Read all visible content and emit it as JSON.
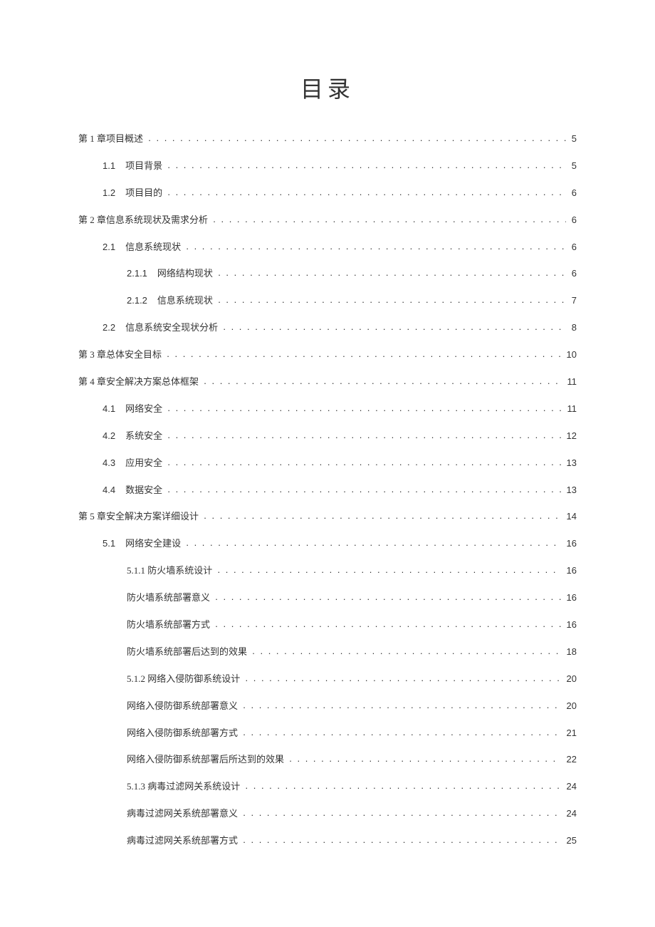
{
  "title": "目录",
  "entries": [
    {
      "indent": 0,
      "num": "",
      "label": "第 1 章项目概述",
      "page": "5"
    },
    {
      "indent": 1,
      "num": "1.1",
      "label": "项目背景",
      "page": "5"
    },
    {
      "indent": 1,
      "num": "1.2",
      "label": "项目目的",
      "page": "6"
    },
    {
      "indent": 0,
      "num": "",
      "label": "第 2 章信息系统现状及需求分析",
      "page": "6"
    },
    {
      "indent": 1,
      "num": "2.1",
      "label": "信息系统现状",
      "page": "6"
    },
    {
      "indent": 2,
      "num": "2.1.1",
      "label": "网络结构现状",
      "page": "6"
    },
    {
      "indent": 2,
      "num": "2.1.2",
      "label": "信息系统现状",
      "page": "7"
    },
    {
      "indent": 1,
      "num": "2.2",
      "label": "信息系统安全现状分析",
      "page": "8"
    },
    {
      "indent": 0,
      "num": "",
      "label": "第 3 章总体安全目标",
      "page": "10"
    },
    {
      "indent": 0,
      "num": "",
      "label": "第 4 章安全解决方案总体框架",
      "page": "11"
    },
    {
      "indent": 1,
      "num": "4.1",
      "label": "网络安全",
      "page": "11"
    },
    {
      "indent": 1,
      "num": "4.2",
      "label": "系统安全",
      "page": "12"
    },
    {
      "indent": 1,
      "num": "4.3",
      "label": "应用安全",
      "page": "13"
    },
    {
      "indent": 1,
      "num": "4.4",
      "label": "数据安全",
      "page": "13"
    },
    {
      "indent": 0,
      "num": "",
      "label": "第 5 章安全解决方案详细设计",
      "page": "14"
    },
    {
      "indent": 1,
      "num": "5.1",
      "label": "网络安全建设",
      "page": "16"
    },
    {
      "indent": 2,
      "num": "",
      "label": "5.1.1 防火墙系统设计",
      "page": "16"
    },
    {
      "indent": 2,
      "num": "",
      "label": "防火墙系统部署意义",
      "page": "16"
    },
    {
      "indent": 2,
      "num": "",
      "label": "防火墙系统部署方式",
      "page": "16"
    },
    {
      "indent": 2,
      "num": "",
      "label": "防火墙系统部署后达到的效果",
      "page": "18"
    },
    {
      "indent": 2,
      "num": "",
      "label": "5.1.2 网络入侵防御系统设计",
      "page": "20"
    },
    {
      "indent": 2,
      "num": "",
      "label": "网络入侵防御系统部署意义",
      "page": "20"
    },
    {
      "indent": 2,
      "num": "",
      "label": "网络入侵防御系统部署方式",
      "page": "21"
    },
    {
      "indent": 2,
      "num": "",
      "label": "网络入侵防御系统部署后所达到的效果",
      "page": "22"
    },
    {
      "indent": 2,
      "num": "",
      "label": "5.1.3 病毒过滤网关系统设计",
      "page": "24"
    },
    {
      "indent": 2,
      "num": "",
      "label": "病毒过滤网关系统部署意义",
      "page": "24"
    },
    {
      "indent": 2,
      "num": "",
      "label": "病毒过滤网关系统部署方式",
      "page": "25"
    }
  ]
}
